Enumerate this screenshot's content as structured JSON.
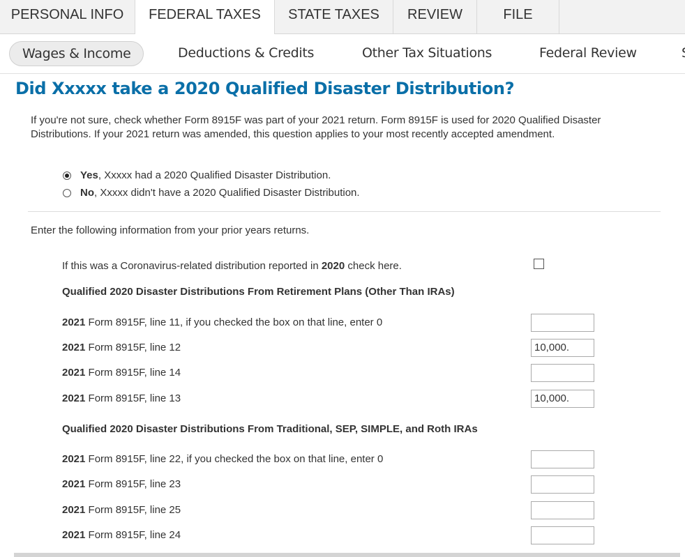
{
  "top_tabs": [
    "PERSONAL INFO",
    "FEDERAL TAXES",
    "STATE TAXES",
    "REVIEW",
    "FILE"
  ],
  "sub_tabs": [
    "Wages & Income",
    "Deductions & Credits",
    "Other Tax Situations",
    "Federal Review",
    "S"
  ],
  "question_title": "Did Xxxxx take a 2020 Qualified Disaster Distribution?",
  "intro": "If you're not sure, check whether Form 8915F was part of your 2021 return. Form 8915F is used for 2020 Qualified Disaster Distributions. If your 2021 return was amended, this question applies to your most recently accepted amendment.",
  "radio_yes": {
    "bold": "Yes",
    "rest": ", Xxxxx had a 2020 Qualified Disaster Distribution."
  },
  "radio_no": {
    "bold": "No",
    "rest": ", Xxxxx didn't have a 2020 Qualified Disaster Distribution."
  },
  "enter_info": "Enter the following information from your prior years returns.",
  "covid": {
    "pre": "If this was a Coronavirus-related distribution reported in ",
    "bold": "2020",
    "post": " check here."
  },
  "section1_title": "Qualified 2020 Disaster Distributions From Retirement Plans (Other Than IRAs)",
  "section1_lines": [
    {
      "year": "2021",
      "text": " Form 8915F, line 11, if you checked the box on that line, enter 0",
      "value": ""
    },
    {
      "year": "2021",
      "text": " Form 8915F, line 12",
      "value": "10,000."
    },
    {
      "year": "2021",
      "text": " Form 8915F, line 14",
      "value": ""
    },
    {
      "year": "2021",
      "text": " Form 8915F, line 13",
      "value": "10,000."
    }
  ],
  "section2_title": "Qualified 2020 Disaster Distributions From Traditional, SEP, SIMPLE, and Roth IRAs",
  "section2_lines": [
    {
      "year": "2021",
      "text": " Form 8915F, line 22, if you checked the box on that line, enter 0",
      "value": ""
    },
    {
      "year": "2021",
      "text": " Form 8915F, line 23",
      "value": ""
    },
    {
      "year": "2021",
      "text": " Form 8915F, line 25",
      "value": ""
    },
    {
      "year": "2021",
      "text": " Form 8915F, line 24",
      "value": ""
    }
  ]
}
